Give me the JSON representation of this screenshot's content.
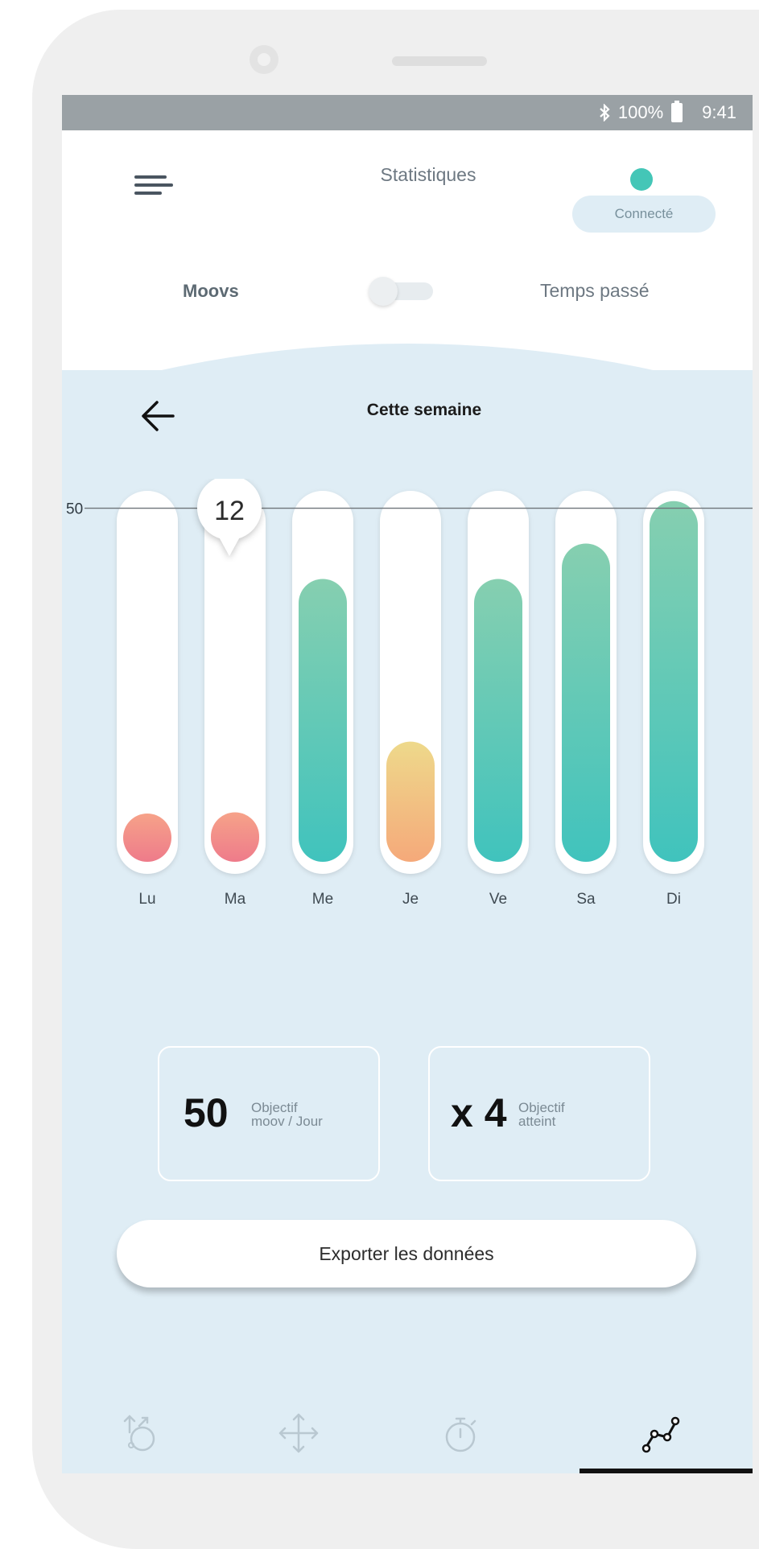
{
  "status_bar": {
    "bluetooth_icon": "bluetooth-icon",
    "battery": "100%",
    "time": "9:41"
  },
  "header": {
    "title": "Statistiques",
    "connection_status": "Connecté",
    "connection_color": "#44c6b7",
    "toggle": {
      "left_label": "Moovs",
      "right_label": "Temps passé",
      "state": "off"
    }
  },
  "week": {
    "label": "Cette semaine"
  },
  "tooltip": {
    "value": "12"
  },
  "chart_data": {
    "type": "bar",
    "categories": [
      "Lu",
      "Ma",
      "Me",
      "Je",
      "Ve",
      "Sa",
      "Di"
    ],
    "values": [
      6,
      7,
      40,
      17,
      40,
      45,
      51
    ],
    "target": 50,
    "target_label": "50",
    "ylim": [
      0,
      52
    ],
    "colors": {
      "low": [
        "#f6a289",
        "#ee7b8a"
      ],
      "mid": [
        "#eed98b",
        "#f5a97a"
      ],
      "high": [
        "#86cfb0",
        "#40c3bd"
      ]
    }
  },
  "stats": [
    {
      "number": "50",
      "line1": "Objectif",
      "line2": "moov / Jour"
    },
    {
      "number": "x 4",
      "line1": "Objectif",
      "line2": "atteint"
    }
  ],
  "export_button": {
    "label": "Exporter les données"
  },
  "bottom_nav": [
    {
      "icon": "rotation-icon",
      "active": false
    },
    {
      "icon": "move-arrows-icon",
      "active": false
    },
    {
      "icon": "stopwatch-icon",
      "active": false
    },
    {
      "icon": "statistics-icon",
      "active": true
    }
  ]
}
